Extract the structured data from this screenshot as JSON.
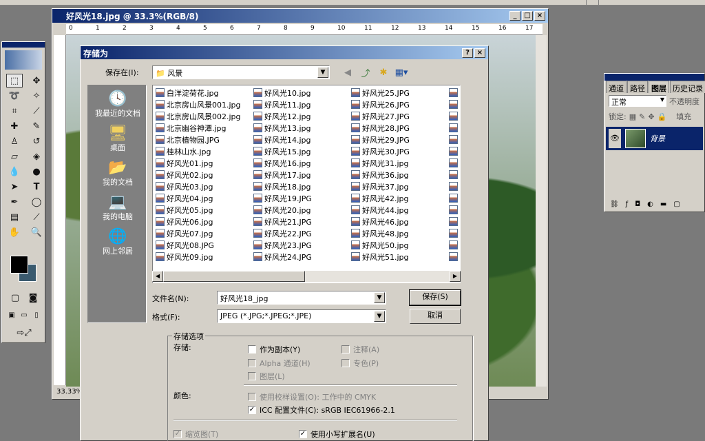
{
  "document": {
    "title": "好风光18.jpg @ 33.3%(RGB/8)",
    "zoom_status": "33.33%",
    "ruler_marks": [
      "0",
      "1",
      "2",
      "3",
      "4",
      "5",
      "6",
      "7",
      "8",
      "9",
      "10",
      "11",
      "12",
      "13",
      "14",
      "15",
      "16",
      "17"
    ]
  },
  "layers_panel": {
    "tabs": [
      "通道",
      "路径",
      "图层",
      "历史记录"
    ],
    "active_tab": "图层",
    "blend_mode": "正常",
    "opacity_label": "不透明度",
    "lock_label": "锁定:",
    "fill_label": "填充",
    "layer_name": "背景"
  },
  "dialog": {
    "title": "存储为",
    "save_in_label": "保存在(I):",
    "current_folder": "风景",
    "places": [
      {
        "label": "我最近的文档",
        "icon": "recent-docs-icon"
      },
      {
        "label": "桌面",
        "icon": "desktop-icon"
      },
      {
        "label": "我的文档",
        "icon": "my-documents-icon"
      },
      {
        "label": "我的电脑",
        "icon": "my-computer-icon"
      },
      {
        "label": "网上邻居",
        "icon": "network-icon"
      }
    ],
    "files_col1": [
      "白洋淀荷花.jpg",
      "北京房山风景001.jpg",
      "北京房山风景002.jpg",
      "北京幽谷神潭.jpg",
      "北京植物园.JPG",
      "桂林山水.jpg",
      "好风光01.jpg",
      "好风光02.jpg",
      "好风光03.jpg",
      "好风光04.jpg",
      "好风光05.jpg",
      "好风光06.jpg",
      "好风光07.jpg",
      "好风光08.JPG",
      "好风光09.jpg"
    ],
    "files_col2": [
      "好风光10.jpg",
      "好风光11.jpg",
      "好风光12.jpg",
      "好风光13.jpg",
      "好风光14.jpg",
      "好风光15.jpg",
      "好风光16.jpg",
      "好风光17.jpg",
      "好风光18.jpg",
      "好风光19.JPG",
      "好风光20.jpg",
      "好风光21.JPG",
      "好风光22.JPG",
      "好风光23.JPG",
      "好风光24.JPG"
    ],
    "files_col3": [
      "好风光25.JPG",
      "好风光26.JPG",
      "好风光27.JPG",
      "好风光28.JPG",
      "好风光29.JPG",
      "好风光30.JPG",
      "好风光31.jpg",
      "好风光36.jpg",
      "好风光37.jpg",
      "好风光42.jpg",
      "好风光44.jpg",
      "好风光46.jpg",
      "好风光48.jpg",
      "好风光50.jpg",
      "好风光51.jpg"
    ],
    "filename_label": "文件名(N):",
    "filename_value": "好风光18_jpg",
    "format_label": "格式(F):",
    "format_value": "JPEG (*.JPG;*.JPEG;*.JPE)",
    "save_button": "保存(S)",
    "cancel_button": "取消",
    "options_title": "存储选项",
    "save_group_label": "存储:",
    "opt_as_copy": "作为副本(Y)",
    "opt_annotations": "注释(A)",
    "opt_alpha": "Alpha 通道(H)",
    "opt_spot": "专色(P)",
    "opt_layers": "图层(L)",
    "color_label": "颜色:",
    "opt_proof": "使用校样设置(O): 工作中的 CMYK",
    "opt_icc": "ICC 配置文件(C): sRGB IEC61966-2.1",
    "opt_thumbnail": "缩览图(T)",
    "opt_lowercase": "使用小写扩展名(U)"
  },
  "colors": {
    "titlebar": "#0a246a",
    "dialog_bg": "#d4d0c8",
    "places_bg": "#808080",
    "foreground_swatch": "#000000",
    "background_swatch": "#3a5a6e"
  }
}
